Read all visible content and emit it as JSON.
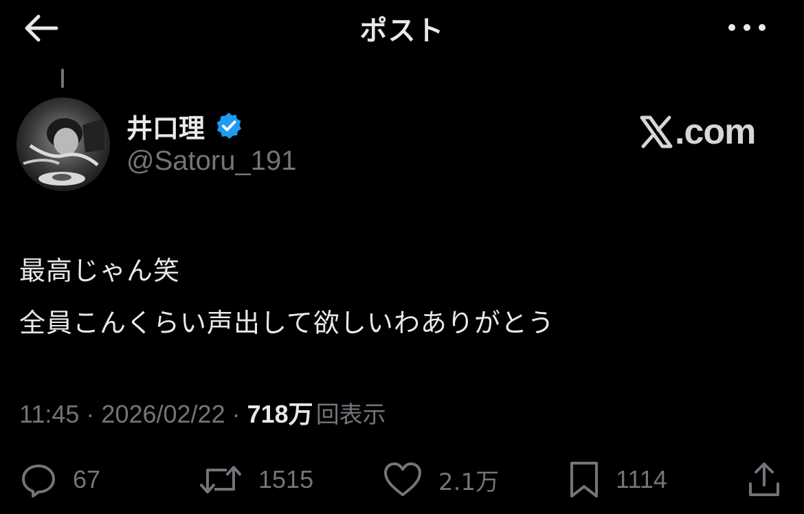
{
  "header": {
    "title": "ポスト",
    "back_icon": "arrow-left-icon",
    "more_icon": "more-horizontal-icon"
  },
  "author": {
    "display_name": "井口理",
    "handle": "@Satoru_191",
    "verified": true,
    "verified_color": "#1d9bf0"
  },
  "watermark": {
    "text": ".com"
  },
  "post": {
    "lines": [
      "最高じゃん笑",
      "全員こんくらい声出して欲しいわありがとう"
    ]
  },
  "meta": {
    "time": "11:45",
    "separator": "·",
    "date": "2026/02/22",
    "views_count": "718万",
    "views_label": "回表示"
  },
  "actions": {
    "replies": "67",
    "reposts": "1515",
    "likes": "2.1万",
    "bookmarks": "1114"
  },
  "colors": {
    "background": "#000000",
    "text_primary": "#e7e9ea",
    "text_secondary": "#71767b",
    "accent": "#1d9bf0"
  }
}
